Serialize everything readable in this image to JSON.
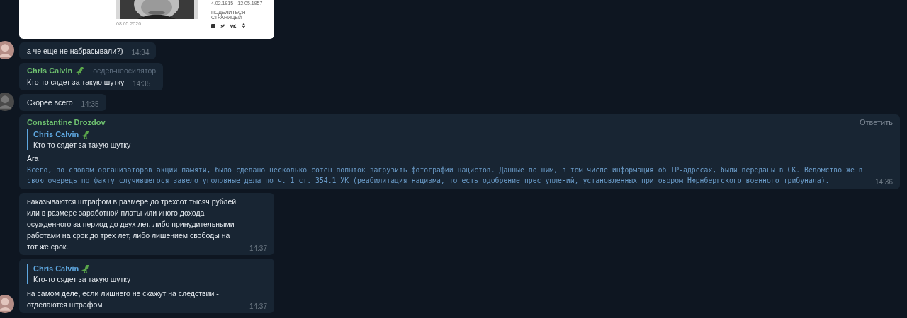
{
  "link_preview": {
    "lifespan": "4.02.1915 - 12.05.1957",
    "share_label": "ПОДЕЛИТЬСЯ СТРАНИЦЕЙ",
    "date": "08.05.2020"
  },
  "messages": [
    {
      "kind": "plain",
      "avatar": true,
      "text": "а че еще не набрасывали?)",
      "time": "14:34"
    },
    {
      "kind": "plain",
      "avatar": false,
      "sender": {
        "name": "Chris Calvin",
        "dino": true
      },
      "rank": "осдев-неосилятор",
      "text": "Кто-то сядет за такую шутку",
      "time": "14:35"
    },
    {
      "kind": "plain",
      "avatar": true,
      "text": "Скорее всего",
      "time": "14:35"
    },
    {
      "kind": "wide",
      "avatar": false,
      "sender": {
        "name": "Constantine Drozdov",
        "dino": false
      },
      "action": "Ответить",
      "quote": {
        "name": "Chris Calvin",
        "dino": true,
        "text": "Кто-то сядет за такую шутку"
      },
      "text": "Ага",
      "code": "Всего, по словам организаторов акции памяти, было сделано несколько сотен попыток загрузить фотографии нацистов. Данные по ним, в том числе информация об IP-адресах, были переданы в СК. Ведомство же в свою очередь по факту случившегося завело уголовные дела по ч. 1 ст. 354.1 УК (реабилитация нацизма, то есть одобрение преступлений, установленных приговором Нюрнбергского военного трибунала).",
      "time": "14:36"
    },
    {
      "kind": "plain",
      "avatar": false,
      "text": "наказываются штрафом в размере до трехсот тысяч рублей или в размере заработной платы или иного дохода осужденного за период до двух лет, либо принудительными работами на срок до трех лет, либо лишением свободы на тот же срок.",
      "time": "14:37"
    },
    {
      "kind": "plain",
      "avatar": true,
      "quote": {
        "name": "Chris Calvin",
        "dino": true,
        "text": "Кто-то сядет за такую шутку"
      },
      "text": "на самом деле, если лишнего не скажут на следствии - отделаются штрафом",
      "time": "14:37"
    }
  ]
}
